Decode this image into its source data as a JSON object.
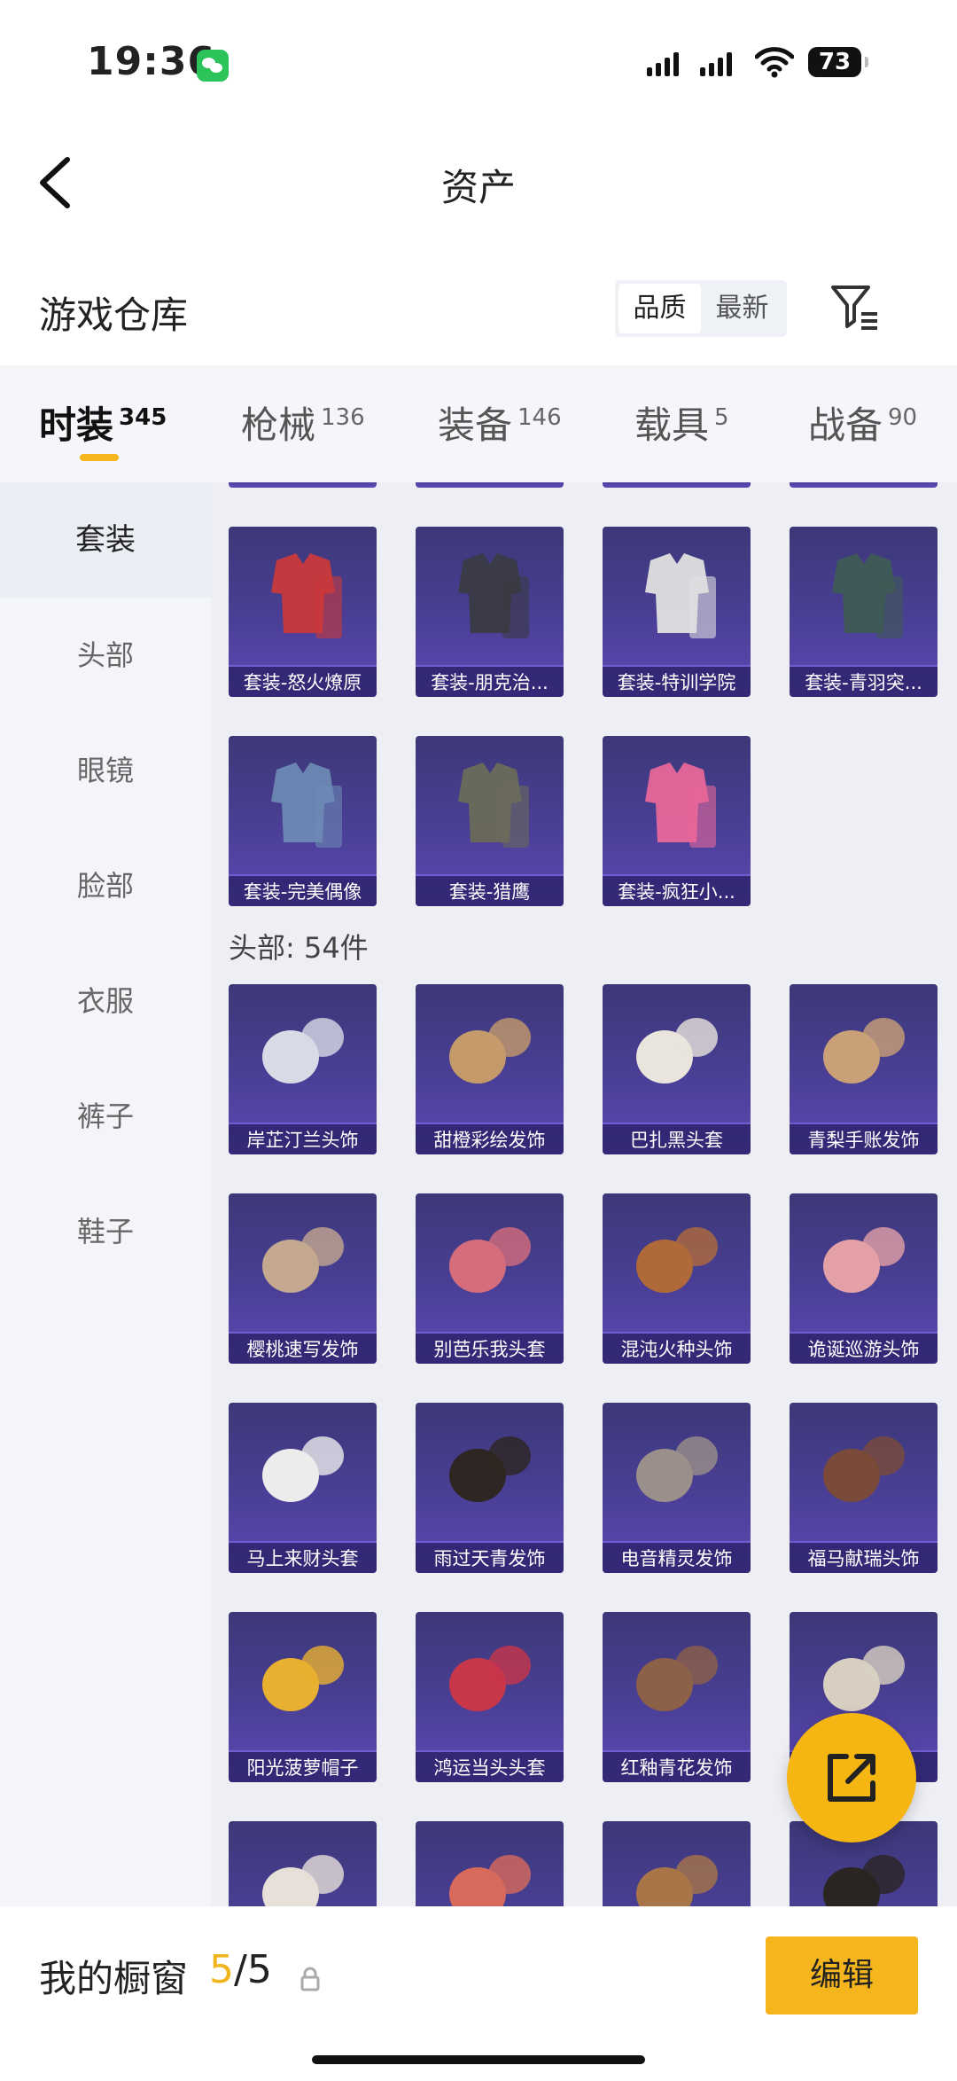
{
  "status": {
    "time": "19:36",
    "battery": "73"
  },
  "nav": {
    "title": "资产"
  },
  "header": {
    "title": "游戏仓库",
    "sort_options": [
      "品质",
      "最新"
    ]
  },
  "tabs": [
    {
      "label": "时装",
      "count": "345"
    },
    {
      "label": "枪械",
      "count": "136"
    },
    {
      "label": "装备",
      "count": "146"
    },
    {
      "label": "载具",
      "count": "5"
    },
    {
      "label": "战备",
      "count": "90"
    }
  ],
  "sidebar": {
    "items": [
      "套装",
      "头部",
      "眼镜",
      "脸部",
      "衣服",
      "裤子",
      "鞋子"
    ]
  },
  "suits": [
    {
      "label": "套装-怒火燎原"
    },
    {
      "label": "套装-朋克治..."
    },
    {
      "label": "套装-特训学院"
    },
    {
      "label": "套装-青羽突..."
    },
    {
      "label": "套装-完美偶像"
    },
    {
      "label": "套装-猎鹰"
    },
    {
      "label": "套装-疯狂小..."
    }
  ],
  "head_section": {
    "title": "头部: 54件"
  },
  "head_items": [
    {
      "label": "岸芷汀兰头饰"
    },
    {
      "label": "甜橙彩绘发饰"
    },
    {
      "label": "巴扎黑头套"
    },
    {
      "label": "青梨手账发饰"
    },
    {
      "label": "樱桃速写发饰"
    },
    {
      "label": "别芭乐我头套"
    },
    {
      "label": "混沌火种头饰"
    },
    {
      "label": "诡诞巡游头饰"
    },
    {
      "label": "马上来财头套"
    },
    {
      "label": "雨过天青发饰"
    },
    {
      "label": "电音精灵发饰"
    },
    {
      "label": "福马献瑞头饰"
    },
    {
      "label": "阳光菠萝帽子"
    },
    {
      "label": "鸿运当头头套"
    },
    {
      "label": "红釉青花发饰"
    },
    {
      "label": ""
    },
    {
      "label": ""
    },
    {
      "label": ""
    },
    {
      "label": ""
    },
    {
      "label": ""
    }
  ],
  "bottom": {
    "label": "我的橱窗",
    "current": "5",
    "total": "/5",
    "edit_label": "编辑"
  }
}
